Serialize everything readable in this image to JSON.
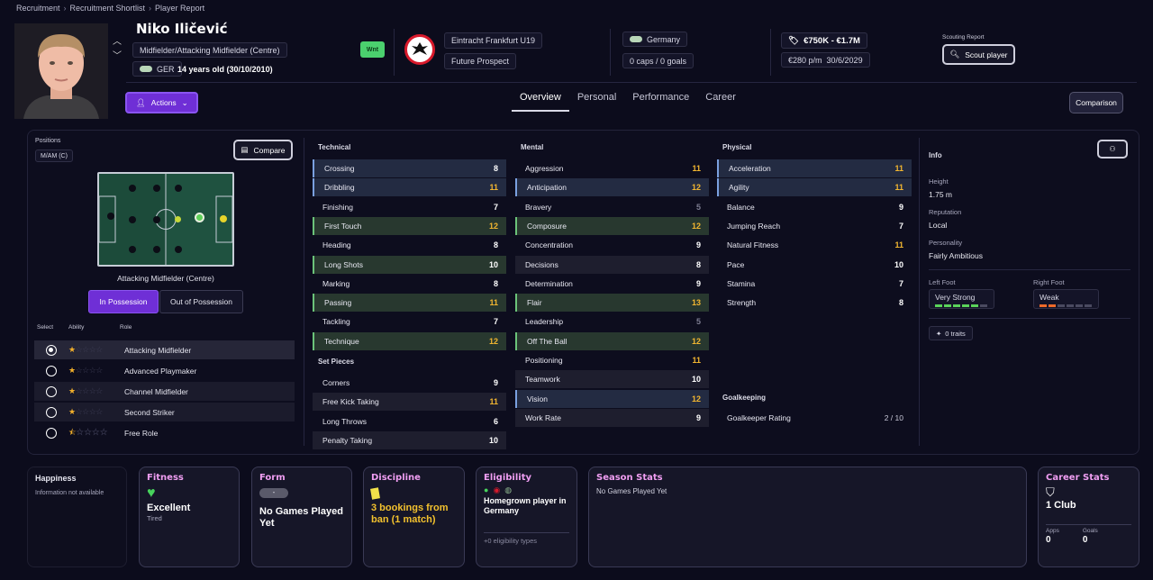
{
  "breadcrumbs": [
    "Recruitment",
    "Recruitment Shortlist",
    "Player Report"
  ],
  "player": {
    "name": "Niko Iličević",
    "position": "Midfielder/Attacking Midfielder (Centre)",
    "nation": "GER",
    "age": "14 years old (30/10/2010)",
    "status_badge": "Wnt",
    "club": "Eintracht Frankfurt U19",
    "club_status": "Future Prospect",
    "intl_nation": "Germany",
    "caps": "0 caps / 0 goals",
    "value": "€750K - €1.7M",
    "wage": "€280 p/m",
    "contract": "30/6/2029",
    "scouting_label": "Scouting Report",
    "scout_button": "Scout player"
  },
  "actions_label": "Actions",
  "tabs": [
    "Overview",
    "Personal",
    "Performance",
    "Career"
  ],
  "comparison_label": "Comparison",
  "positions": {
    "label": "Positions",
    "tag": "M/AM (C)",
    "compare_label": "Compare",
    "pitch_caption": "Attacking Midfielder (Centre)",
    "toggle": [
      "In Possession",
      "Out of Possession"
    ],
    "headers": [
      "Select",
      "Ability",
      "Role"
    ],
    "roles": [
      {
        "name": "Attacking Midfielder",
        "stars": 1,
        "selected": true
      },
      {
        "name": "Advanced Playmaker",
        "stars": 1,
        "selected": false
      },
      {
        "name": "Channel Midfielder",
        "stars": 1,
        "selected": false
      },
      {
        "name": "Second Striker",
        "stars": 1,
        "selected": false
      },
      {
        "name": "Free Role",
        "stars": 0.5,
        "selected": false
      }
    ]
  },
  "technical": {
    "title": "Technical",
    "attrs": [
      {
        "name": "Crossing",
        "value": "8"
      },
      {
        "name": "Dribbling",
        "value": "11"
      },
      {
        "name": "Finishing",
        "value": "7"
      },
      {
        "name": "First Touch",
        "value": "12"
      },
      {
        "name": "Heading",
        "value": "8"
      },
      {
        "name": "Long Shots",
        "value": "10"
      },
      {
        "name": "Marking",
        "value": "8"
      },
      {
        "name": "Passing",
        "value": "11"
      },
      {
        "name": "Tackling",
        "value": "7"
      },
      {
        "name": "Technique",
        "value": "12"
      }
    ]
  },
  "set_pieces": {
    "title": "Set Pieces",
    "attrs": [
      {
        "name": "Corners",
        "value": "9"
      },
      {
        "name": "Free Kick Taking",
        "value": "11"
      },
      {
        "name": "Long Throws",
        "value": "6"
      },
      {
        "name": "Penalty Taking",
        "value": "10"
      }
    ]
  },
  "mental": {
    "title": "Mental",
    "attrs": [
      {
        "name": "Aggression",
        "value": "11"
      },
      {
        "name": "Anticipation",
        "value": "12"
      },
      {
        "name": "Bravery",
        "value": "5"
      },
      {
        "name": "Composure",
        "value": "12"
      },
      {
        "name": "Concentration",
        "value": "9"
      },
      {
        "name": "Decisions",
        "value": "8"
      },
      {
        "name": "Determination",
        "value": "9"
      },
      {
        "name": "Flair",
        "value": "13"
      },
      {
        "name": "Leadership",
        "value": "5"
      },
      {
        "name": "Off The Ball",
        "value": "12"
      },
      {
        "name": "Positioning",
        "value": "11"
      },
      {
        "name": "Teamwork",
        "value": "10"
      },
      {
        "name": "Vision",
        "value": "12"
      },
      {
        "name": "Work Rate",
        "value": "9"
      }
    ]
  },
  "physical": {
    "title": "Physical",
    "attrs": [
      {
        "name": "Acceleration",
        "value": "11"
      },
      {
        "name": "Agility",
        "value": "11"
      },
      {
        "name": "Balance",
        "value": "9"
      },
      {
        "name": "Jumping Reach",
        "value": "7"
      },
      {
        "name": "Natural Fitness",
        "value": "11"
      },
      {
        "name": "Pace",
        "value": "10"
      },
      {
        "name": "Stamina",
        "value": "7"
      },
      {
        "name": "Strength",
        "value": "8"
      }
    ]
  },
  "goalkeeping": {
    "title": "Goalkeeping",
    "label": "Goalkeeper Rating",
    "value": "2 / 10"
  },
  "info": {
    "title": "Info",
    "height_label": "Height",
    "height": "1.75 m",
    "reputation_label": "Reputation",
    "reputation": "Local",
    "personality_label": "Personality",
    "personality": "Fairly Ambitious",
    "left_foot_label": "Left Foot",
    "left_foot": "Very Strong",
    "left_foot_level": 5,
    "right_foot_label": "Right Foot",
    "right_foot": "Weak",
    "right_foot_level": 2,
    "traits": "0 traits"
  },
  "cards": {
    "happiness": {
      "title": "Happiness",
      "text": "Information not available"
    },
    "fitness": {
      "title": "Fitness",
      "value": "Excellent",
      "sub": "Tired"
    },
    "form": {
      "title": "Form",
      "badge": "-",
      "value": "No Games Played Yet"
    },
    "discipline": {
      "title": "Discipline",
      "value": "3 bookings from ban (1 match)"
    },
    "eligibility": {
      "title": "Eligibility",
      "value": "Homegrown player in Germany",
      "more": "+0 eligibility types"
    },
    "season": {
      "title": "Season Stats",
      "text": "No Games Played Yet"
    },
    "career": {
      "title": "Career Stats",
      "value": "1 Club",
      "apps_label": "Apps",
      "apps": "0",
      "goals_label": "Goals",
      "goals": "0"
    }
  },
  "colors": {
    "accent": "#6f2fd6",
    "highlight": "#f2b630",
    "card_title": "#f09ef2",
    "wanted": "#4bd06e"
  }
}
